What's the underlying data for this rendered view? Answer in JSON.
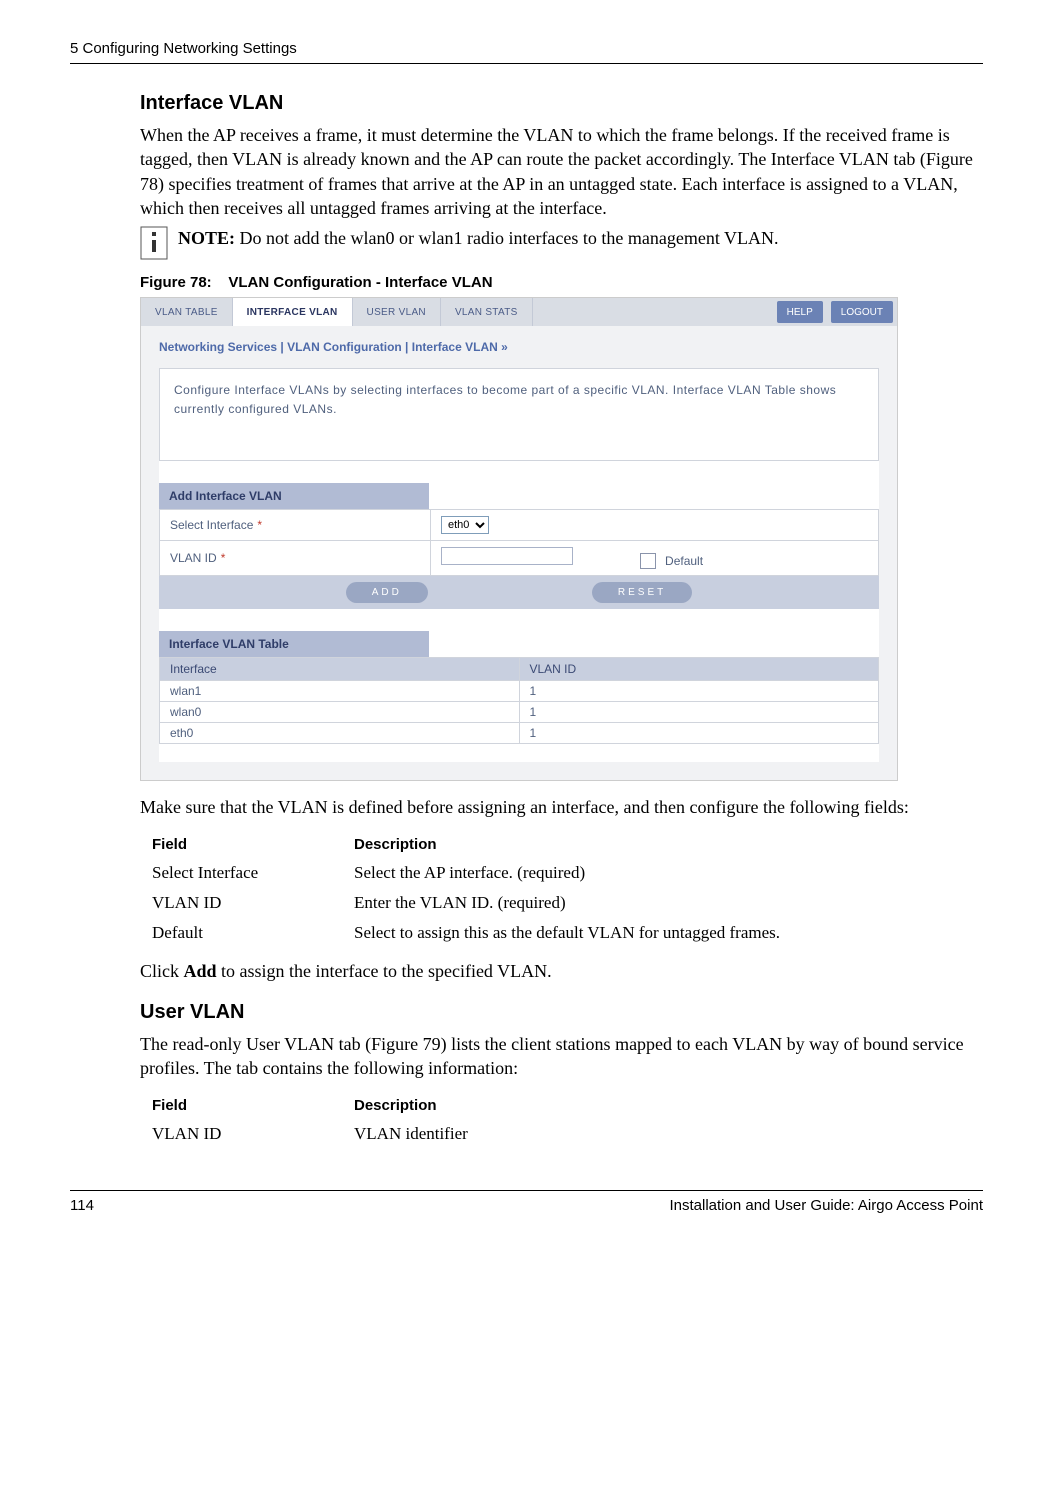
{
  "header": {
    "chapter": "5  Configuring Networking Settings"
  },
  "section1": {
    "title": "Interface VLAN",
    "para": "When the AP receives a frame, it must determine the VLAN to which the frame belongs. If the received frame is tagged, then VLAN is already known and the AP can route the packet accordingly. The Interface VLAN tab (Figure 78) specifies treatment of frames that arrive at the AP in an untagged state. Each interface is assigned to a VLAN, which then receives all untagged frames arriving at the interface.",
    "note_label": "NOTE:",
    "note_text": " Do not add the wlan0 or wlan1 radio interfaces to the management VLAN.",
    "figcap_prefix": "Figure 78:",
    "figcap_text": "VLAN Configuration - Interface VLAN"
  },
  "screenshot": {
    "tabs": [
      "VLAN TABLE",
      "INTERFACE VLAN",
      "USER VLAN",
      "VLAN STATS"
    ],
    "active_tab_index": 1,
    "help": "HELP",
    "logout": "LOGOUT",
    "breadcrumb": "Networking Services | VLAN Configuration | Interface VLAN  »",
    "info": "Configure Interface VLANs by selecting interfaces to become part of a specific VLAN. Interface VLAN Table shows currently configured VLANs.",
    "panel_add": "Add Interface VLAN",
    "row_select": "Select Interface",
    "row_vlan": "VLAN ID",
    "select_value": "eth0",
    "default_label": "Default",
    "btn_add": "ADD",
    "btn_reset": "RESET",
    "panel_table": "Interface VLAN Table",
    "col_interface": "Interface",
    "col_vlanid": "VLAN ID",
    "rows": [
      {
        "iface": "wlan1",
        "vid": "1"
      },
      {
        "iface": "wlan0",
        "vid": "1"
      },
      {
        "iface": "eth0",
        "vid": "1"
      }
    ]
  },
  "after_fig": {
    "para": "Make sure that the VLAN is defined before assigning an interface, and then configure the following fields:",
    "table_head_field": "Field",
    "table_head_desc": "Description",
    "rows": [
      {
        "f": "Select Interface",
        "d": "Select the AP interface. (required)"
      },
      {
        "f": "VLAN ID",
        "d": "Enter the VLAN ID. (required)"
      },
      {
        "f": "Default",
        "d": "Select to assign this as the default VLAN for untagged frames."
      }
    ],
    "click_pre": "Click ",
    "click_bold": "Add",
    "click_post": " to assign the interface to the specified VLAN."
  },
  "section2": {
    "title": "User VLAN",
    "para": "The read-only User VLAN tab (Figure 79) lists the client stations mapped to each VLAN by way of bound service profiles. The tab contains the following information:",
    "table_head_field": "Field",
    "table_head_desc": "Description",
    "rows": [
      {
        "f": "VLAN ID",
        "d": "VLAN identifier"
      }
    ]
  },
  "footer": {
    "page": "114",
    "right": "Installation and User Guide: Airgo Access Point"
  }
}
